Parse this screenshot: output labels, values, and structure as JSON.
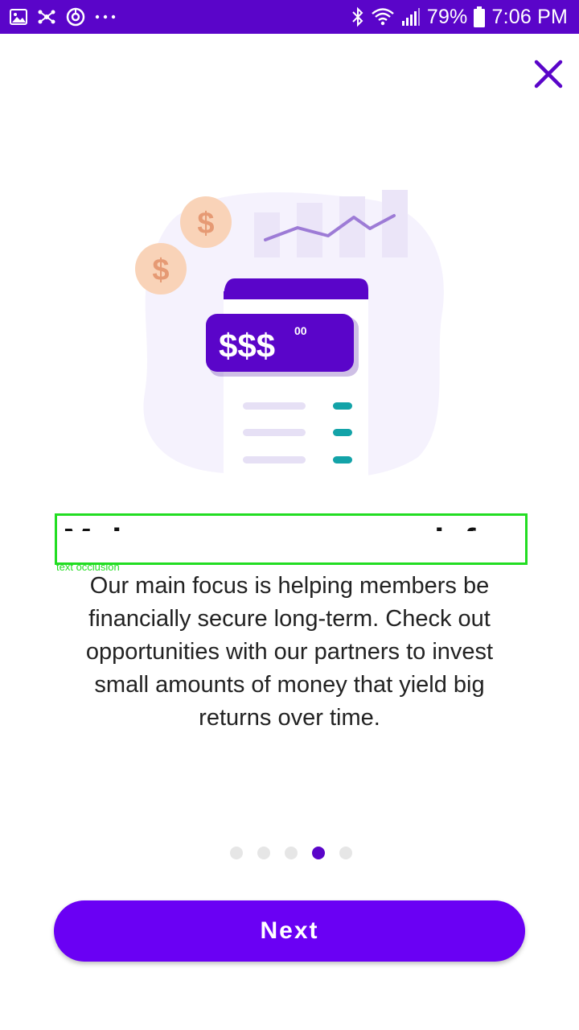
{
  "status_bar": {
    "battery": "79%",
    "time": "7:06 PM",
    "left_icons": [
      "gallery-icon",
      "network-icon",
      "sync-icon",
      "more-icon"
    ],
    "right_icons": [
      "bluetooth-icon",
      "wifi-icon",
      "signal-icon",
      "battery-icon"
    ]
  },
  "close": {
    "icon": "close-icon"
  },
  "illustration": {
    "coin_symbol": "$",
    "card_amount": "$$$",
    "card_cents": "00"
  },
  "title": "Make your money work for you",
  "occlusion_label": "text occlusion",
  "body": "Our main focus is helping members be financially secure long-term. Check out opportunities with our partners to invest small amounts of money that yield big returns over time.",
  "pager": {
    "count": 5,
    "active_index": 3
  },
  "next_button": {
    "label": "Next"
  },
  "colors": {
    "primary": "#5a05c9",
    "button": "#6a00f4",
    "accent_teal": "#13a3a8",
    "coin": "#f9d3b8"
  }
}
